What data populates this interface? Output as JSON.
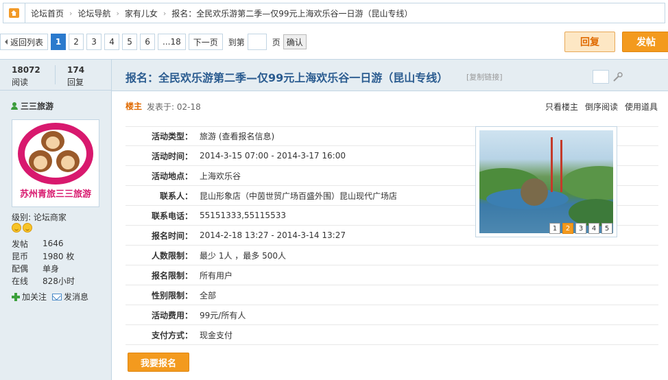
{
  "breadcrumb": {
    "items": [
      "论坛首页",
      "论坛导航",
      "家有儿女",
      "报名：全民欢乐游第二季—仅99元上海欢乐谷一日游（昆山专线）"
    ]
  },
  "pager": {
    "back": "返回列表",
    "pages": [
      "1",
      "2",
      "3",
      "4",
      "5",
      "6",
      "...18"
    ],
    "next": "下一页",
    "goto_prefix": "到第",
    "goto_suffix": "页",
    "confirm": "确认",
    "current": "1"
  },
  "actions": {
    "reply": "回复",
    "post": "发帖"
  },
  "stats": {
    "views": "18072",
    "views_label": "阅读",
    "replies": "174",
    "replies_label": "回复"
  },
  "thread": {
    "title": "报名：全民欢乐游第二季—仅99元上海欢乐谷一日游（昆山专线）",
    "copy_link": "[复制链接]"
  },
  "user": {
    "name": "三三旅游",
    "avatar_text": "苏州青旅三三旅游",
    "level": "级别: 论坛商家",
    "info": [
      {
        "k": "发帖",
        "v": "1646"
      },
      {
        "k": "昆币",
        "v": "1980 枚"
      },
      {
        "k": "配偶",
        "v": "单身"
      },
      {
        "k": "在线",
        "v": "828小时"
      }
    ],
    "follow": "加关注",
    "message": "发消息"
  },
  "post": {
    "louzhu": "楼主",
    "posted": "发表于: 02-18",
    "meta_links": [
      "只看楼主",
      "倒序阅读",
      "使用道具"
    ]
  },
  "activity": [
    {
      "k": "活动类型：",
      "v": "旅游 (查看报名信息)"
    },
    {
      "k": "活动时间：",
      "v": "2014-3-15 07:00 - 2014-3-17 16:00"
    },
    {
      "k": "活动地点：",
      "v": "上海欢乐谷"
    },
    {
      "k": "联系人：",
      "v": "昆山形象店（中茵世贸广场百盛外围）昆山现代广场店"
    },
    {
      "k": "联系电话：",
      "v": "55151333,55115533"
    },
    {
      "k": "报名时间：",
      "v": "2014-2-18 13:27 - 2014-3-14 13:27"
    },
    {
      "k": "人数限制：",
      "v": "最少 1人 ，最多 500人"
    },
    {
      "k": "报名限制：",
      "v": "所有用户"
    },
    {
      "k": "性别限制：",
      "v": "全部"
    },
    {
      "k": "活动费用：",
      "v": "99元/所有人"
    },
    {
      "k": "支付方式：",
      "v": "现金支付"
    }
  ],
  "slideshow": {
    "dots": [
      "1",
      "2",
      "3",
      "4",
      "5"
    ],
    "active": "2"
  },
  "join": "我要报名",
  "colors": {
    "accent": "#f39a1e",
    "link_blue": "#2b5c90",
    "frame_blue": "#c2d5e3",
    "panel": "#e5edf2"
  }
}
